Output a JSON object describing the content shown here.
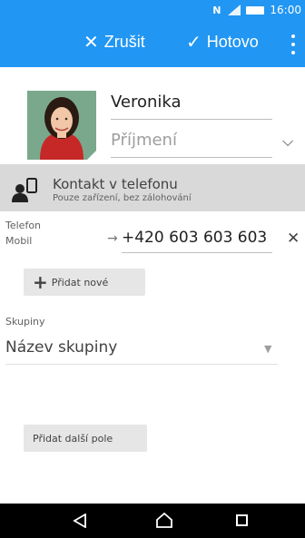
{
  "status_bar": {
    "nfc_label": "N",
    "time": "16:00"
  },
  "action_bar": {
    "cancel_label": "Zrušit",
    "done_label": "Hotovo"
  },
  "contact": {
    "first_name": "Veronika",
    "last_name_placeholder": "Příjmení"
  },
  "account": {
    "title": "Kontakt v telefonu",
    "subtitle": "Pouze zařízení, bez zálohování"
  },
  "phone": {
    "section_label": "Telefon",
    "type_label": "Mobil",
    "number": "+420 603 603 603",
    "add_new_label": "Přidat nové"
  },
  "groups": {
    "section_label": "Skupiny",
    "placeholder": "Název skupiny"
  },
  "more_fields_label": "Přidat další pole",
  "colors": {
    "accent": "#2196f3",
    "account_bar": "#d9d9d9",
    "nav_bar": "#000000"
  }
}
